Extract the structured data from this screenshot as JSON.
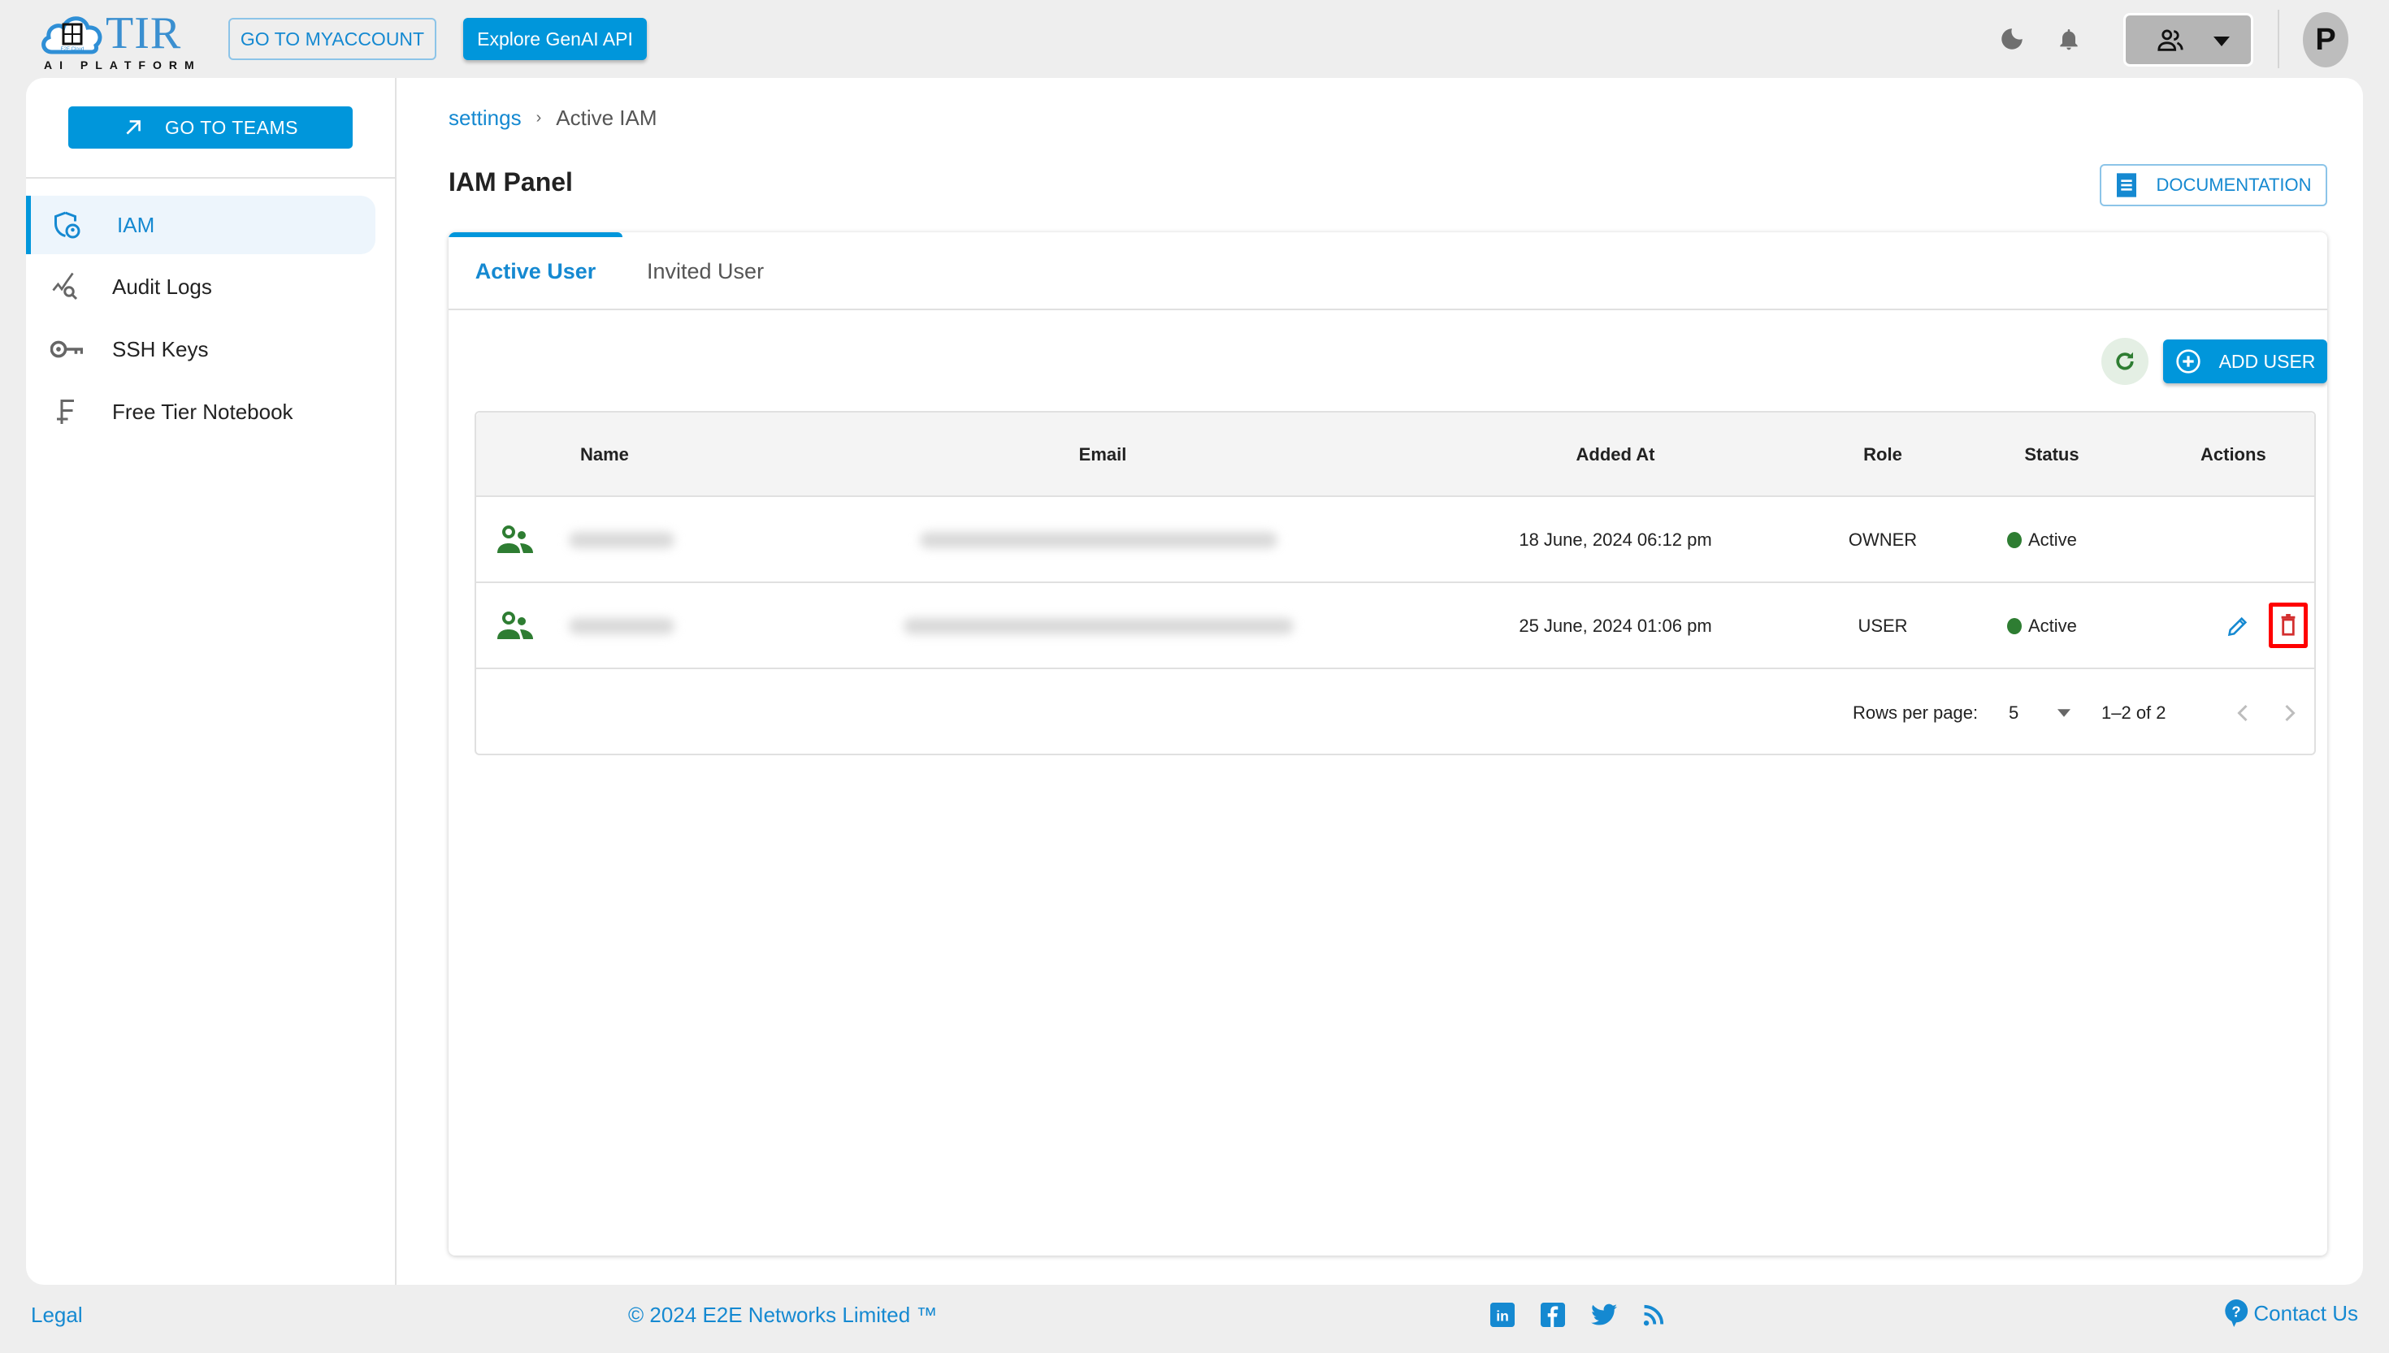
{
  "header": {
    "logo_title": "TIR",
    "logo_subtitle": "AI PLATFORM",
    "logo_badge": "E2E Cloud",
    "myaccount_label": "GO TO MYACCOUNT",
    "genai_label": "Explore GenAI API",
    "avatar_initial": "P",
    "icons": [
      "moon-icon",
      "bell-icon",
      "team-icon",
      "caret-down-icon"
    ]
  },
  "sidebar": {
    "teams_button_label": "GO TO TEAMS",
    "items": [
      {
        "label": "IAM",
        "icon": "shield-user-icon",
        "active": true
      },
      {
        "label": "Audit Logs",
        "icon": "audit-search-icon",
        "active": false
      },
      {
        "label": "SSH Keys",
        "icon": "key-icon",
        "active": false
      },
      {
        "label": "Free Tier Notebook",
        "icon": "free-tier-icon",
        "active": false
      }
    ]
  },
  "breadcrumb": {
    "parent": "settings",
    "separator": "›",
    "current": "Active IAM"
  },
  "page": {
    "title": "IAM Panel",
    "documentation_label": "DOCUMENTATION"
  },
  "tabs": [
    {
      "label": "Active User",
      "active": true
    },
    {
      "label": "Invited User",
      "active": false
    }
  ],
  "toolbar": {
    "add_user_label": "ADD USER"
  },
  "table": {
    "columns": [
      "Name",
      "Email",
      "Added At",
      "Role",
      "Status",
      "Actions"
    ],
    "rows": [
      {
        "name": "[redacted]",
        "email": "[redacted]",
        "added_at": "18 June, 2024 06:12 pm",
        "role": "OWNER",
        "status": "Active",
        "actions": []
      },
      {
        "name": "[redacted]",
        "email": "[redacted]",
        "added_at": "25 June, 2024 01:06 pm",
        "role": "USER",
        "status": "Active",
        "actions": [
          "edit",
          "delete"
        ]
      }
    ]
  },
  "pagination": {
    "rows_per_page_label": "Rows per page:",
    "rows_per_page": "5",
    "range": "1–2 of 2"
  },
  "colors": {
    "primary": "#0096db",
    "status_active": "#2e7d32",
    "delete": "#d32f2f",
    "highlight": "#ff0000"
  },
  "footer": {
    "legal": "Legal",
    "copyright": "© 2024 E2E Networks Limited ™",
    "contact": "Contact Us",
    "social": [
      "linkedin-icon",
      "facebook-icon",
      "twitter-icon",
      "rss-icon"
    ]
  }
}
